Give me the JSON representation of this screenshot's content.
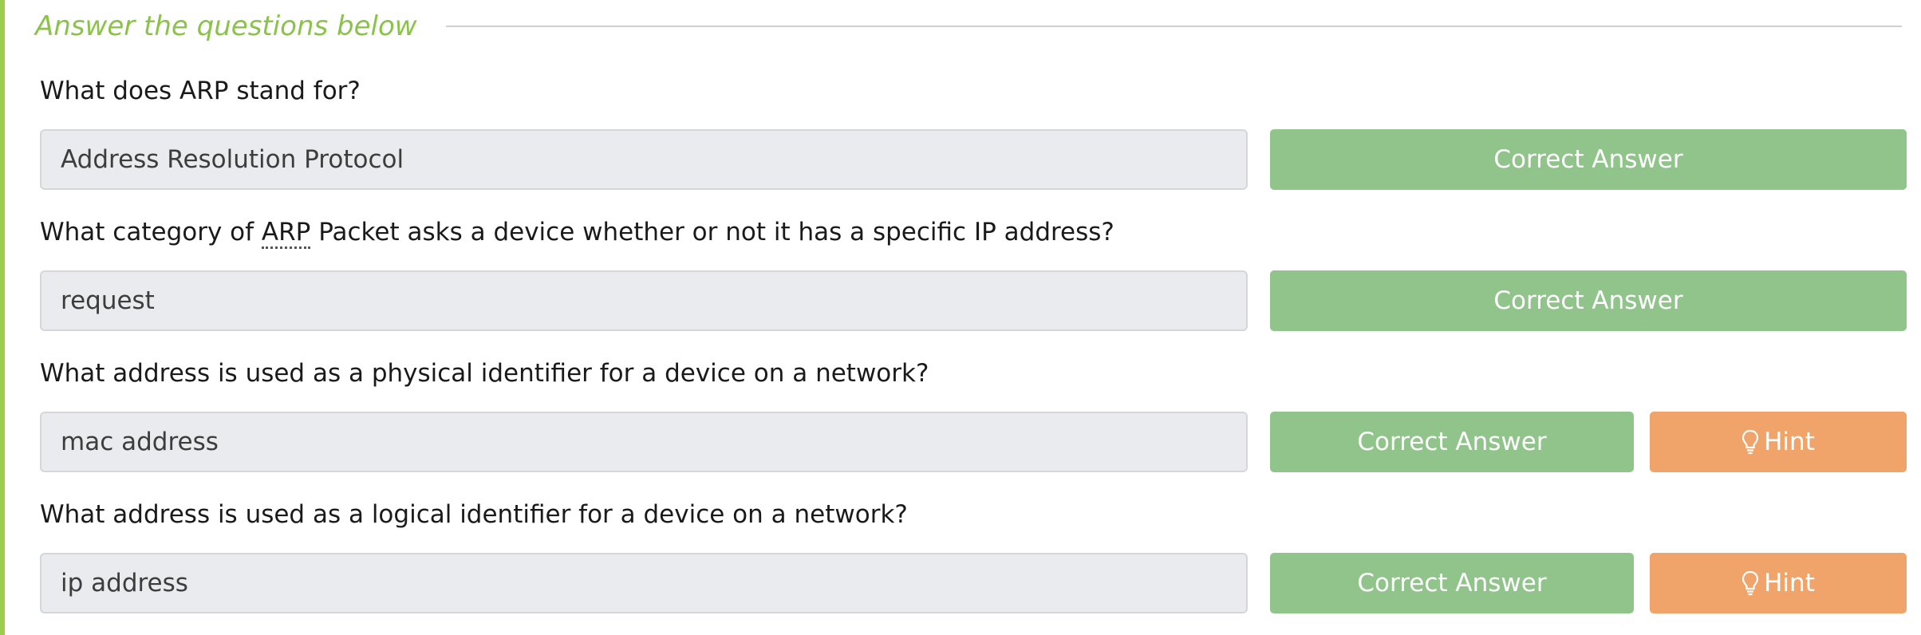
{
  "section": {
    "title": "Answer the questions below"
  },
  "questions": [
    {
      "text_before": "What does ARP stand for?",
      "abbr": "",
      "text_after": "",
      "answer": "Address Resolution Protocol",
      "correct_label": "Correct Answer",
      "hint_label": ""
    },
    {
      "text_before": "What category of ",
      "abbr": "ARP",
      "text_after": " Packet asks a device whether or not it has a specific IP address?",
      "answer": "request",
      "correct_label": "Correct Answer",
      "hint_label": ""
    },
    {
      "text_before": "What address is used as a physical identifier for a device on a network?",
      "abbr": "",
      "text_after": "",
      "answer": "mac address",
      "correct_label": "Correct Answer",
      "hint_label": "Hint"
    },
    {
      "text_before": "What address is used as a logical identifier for a device on a network?",
      "abbr": "",
      "text_after": "",
      "answer": "ip address",
      "correct_label": "Correct Answer",
      "hint_label": "Hint"
    }
  ],
  "colors": {
    "accent": "#8bc34a",
    "correct": "#90c48b",
    "hint": "#f0a46a",
    "input_bg": "#eaebee"
  },
  "icons": {
    "hint": "lightbulb-icon"
  }
}
